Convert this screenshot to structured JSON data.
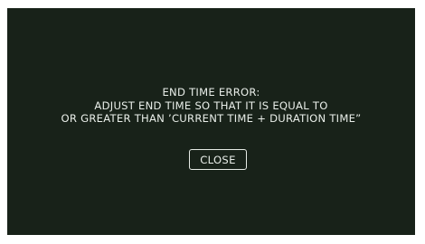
{
  "dialog": {
    "title": "END TIME ERROR:",
    "message_line1": "ADJUST END TIME SO THAT IT IS EQUAL TO",
    "message_line2": "OR GREATER THAN ’CURRENT TIME + DURATION TIME”",
    "close_label": "CLOSE"
  },
  "colors": {
    "background": "#182219",
    "text": "#e9eee9",
    "button_border": "#e6ebe6"
  }
}
